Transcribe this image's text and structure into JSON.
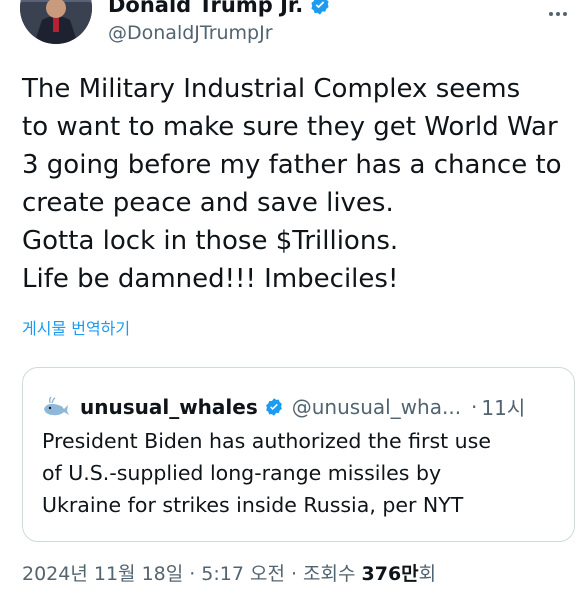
{
  "author": {
    "display_name": "Donald Trump Jr.",
    "handle": "@DonaldJTrumpJr"
  },
  "tweet": {
    "lines": [
      "The Military Industrial Complex seems",
      "to want to make sure they get World War",
      "3 going before my father has a chance to",
      "create peace and save lives.",
      "Gotta lock in those $Trillions.",
      "Life be damned!!! Imbeciles!"
    ]
  },
  "translate_label": "게시물 번역하기",
  "quote": {
    "name": "unusual_whales",
    "handle": "@unusual_wha...",
    "separator": "·",
    "time": "11시",
    "lines": [
      "President Biden has authorized the first use",
      "of U.S.-supplied long-range missiles by",
      "Ukraine for strikes inside Russia, per NYT"
    ]
  },
  "meta": {
    "date": "2024년 11월 18일",
    "separator": "·",
    "time": "5:17 오전",
    "views_label": "조회수",
    "views_number": "376만",
    "views_suffix": "회"
  },
  "colors": {
    "verified_blue": "#1d9bf0",
    "text_primary": "#0f1419",
    "text_secondary": "#536471",
    "border": "#cfd9de"
  },
  "icons": {
    "avatar": "profile-photo",
    "verified": "verified-badge-icon",
    "more": "more-dots-icon",
    "quote_avatar": "whale-icon"
  }
}
